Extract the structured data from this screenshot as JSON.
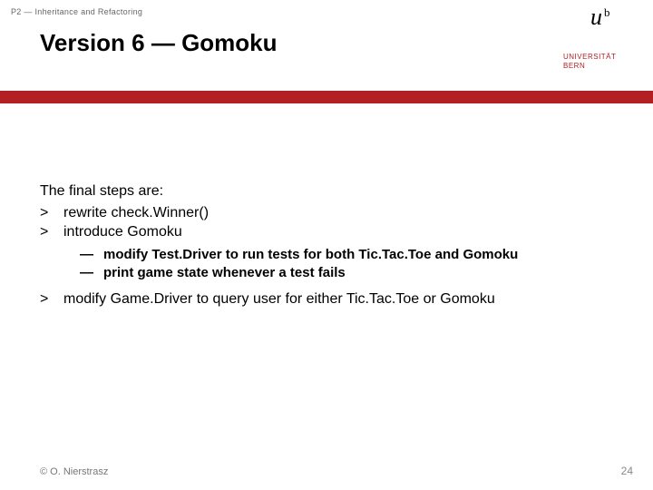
{
  "breadcrumb": "P2 — Inheritance and Refactoring",
  "title": "Version 6 — Gomoku",
  "logo": {
    "u": "u",
    "b": "b",
    "line1": "UNIVERSITÄT",
    "line2": "BERN"
  },
  "content": {
    "lead": "The final steps are:",
    "items": [
      {
        "marker": ">",
        "text": "rewrite check.Winner()"
      },
      {
        "marker": ">",
        "text": "introduce Gomoku",
        "sub": [
          {
            "marker": "—",
            "text": "modify Test.Driver to run tests for both Tic.Tac.Toe and Gomoku"
          },
          {
            "marker": "—",
            "text": "print game state whenever a test fails"
          }
        ]
      },
      {
        "marker": ">",
        "text": "modify Game.Driver to query user for either Tic.Tac.Toe or Gomoku"
      }
    ]
  },
  "footer": {
    "left": "© O. Nierstrasz",
    "right": "24"
  }
}
